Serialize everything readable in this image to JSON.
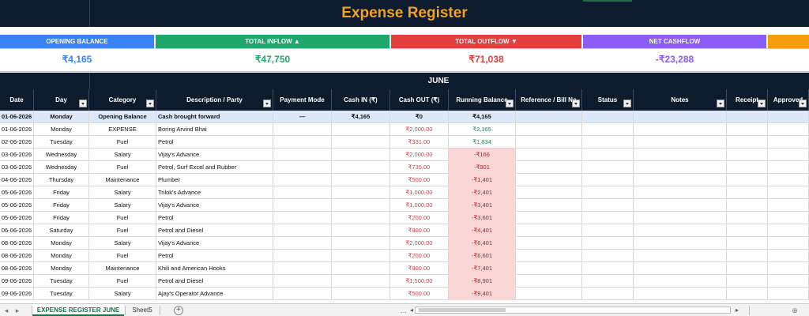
{
  "title": "Expense Register",
  "summary": [
    {
      "label": "OPENING BALANCE",
      "value": "₹4,165",
      "bg": "#3b82f6",
      "color": "#3b82f6"
    },
    {
      "label": "TOTAL INFLOW ▲",
      "value": "₹47,750",
      "bg": "#1fa66a",
      "color": "#1fa66a"
    },
    {
      "label": "TOTAL OUTFLOW ▼",
      "value": "₹71,038",
      "bg": "#e53e3e",
      "color": "#e53e3e"
    },
    {
      "label": "NET CASHFLOW",
      "value": "-₹23,288",
      "bg": "#8b5cf6",
      "color": "#8b5cf6"
    },
    {
      "label": "",
      "value": "",
      "bg": "#f59e0b",
      "color": "#f59e0b"
    }
  ],
  "month": "JUNE",
  "columns": [
    "Date",
    "Day",
    "Category",
    "Description / Party",
    "Payment Mode",
    "Cash IN (₹)",
    "Cash OUT (₹)",
    "Running Balance",
    "Reference / Bill No",
    "Status",
    "Notes",
    "Receipt",
    "Approved"
  ],
  "rows": [
    [
      "01-06-2026",
      "Monday",
      "Opening Balance",
      "Cash brought forward",
      "—",
      "₹4,165",
      "₹0",
      "₹4,165",
      "",
      "",
      "",
      "",
      ""
    ],
    [
      "01-06-2026",
      "Monday",
      "EXPENSE",
      "Boring Arvind Bhai",
      "",
      "",
      "₹2,000.00",
      "₹2,165",
      "",
      "",
      "",
      "",
      ""
    ],
    [
      "02-06-2026",
      "Tuesday",
      "Fuel",
      "Petrol",
      "",
      "",
      "₹331.00",
      "₹1,834",
      "",
      "",
      "",
      "",
      ""
    ],
    [
      "03-06-2026",
      "Wednesday",
      "Salary",
      "Vijay's Advance",
      "",
      "",
      "₹2,000.00",
      "-₹166",
      "",
      "",
      "",
      "",
      ""
    ],
    [
      "03-06-2026",
      "Wednesday",
      "Fuel",
      "Petrol, Surf Excel and Rubber",
      "",
      "",
      "₹735.00",
      "-₹901",
      "",
      "",
      "",
      "",
      ""
    ],
    [
      "04-06-2026",
      "Thursday",
      "Maintenance",
      "Plumber",
      "",
      "",
      "₹500.00",
      "-₹1,401",
      "",
      "",
      "",
      "",
      ""
    ],
    [
      "05-06-2026",
      "Friday",
      "Salary",
      "Trilok's Advance",
      "",
      "",
      "₹1,000.00",
      "-₹2,401",
      "",
      "",
      "",
      "",
      ""
    ],
    [
      "05-06-2026",
      "Friday",
      "Salary",
      "Vijay's Advance",
      "",
      "",
      "₹1,000.00",
      "-₹3,401",
      "",
      "",
      "",
      "",
      ""
    ],
    [
      "05-06-2026",
      "Friday",
      "Fuel",
      "Petrol",
      "",
      "",
      "₹200.00",
      "-₹3,601",
      "",
      "",
      "",
      "",
      ""
    ],
    [
      "06-06-2026",
      "Saturday",
      "Fuel",
      "Petrol and Diesel",
      "",
      "",
      "₹800.00",
      "-₹4,401",
      "",
      "",
      "",
      "",
      ""
    ],
    [
      "08-06-2026",
      "Monday",
      "Salary",
      "Vijay's Advance",
      "",
      "",
      "₹2,000.00",
      "-₹6,401",
      "",
      "",
      "",
      "",
      ""
    ],
    [
      "08-06-2026",
      "Monday",
      "Fuel",
      "Petrol",
      "",
      "",
      "₹200.00",
      "-₹6,601",
      "",
      "",
      "",
      "",
      ""
    ],
    [
      "08-06-2026",
      "Monday",
      "Maintenance",
      "Khili and American Hooks",
      "",
      "",
      "₹800.00",
      "-₹7,401",
      "",
      "",
      "",
      "",
      ""
    ],
    [
      "09-06-2026",
      "Tuesday",
      "Fuel",
      "Petrol and Diesel",
      "",
      "",
      "₹1,500.00",
      "-₹8,901",
      "",
      "",
      "",
      "",
      ""
    ],
    [
      "09-06-2026",
      "Tuesday",
      "Salary",
      "Ajay's Operator Advance",
      "",
      "",
      "₹500.00",
      "-₹9,401",
      "",
      "",
      "",
      "",
      ""
    ]
  ],
  "tabs": {
    "active": "EXPENSE REGISTER JUNE",
    "other": "Sheet5",
    "add": "+",
    "ellipsis": "..."
  },
  "colors": {
    "header_bg": "#0d1b2e",
    "accent_title": "#f4a21d",
    "negative_bg": "#fbd6d6"
  }
}
